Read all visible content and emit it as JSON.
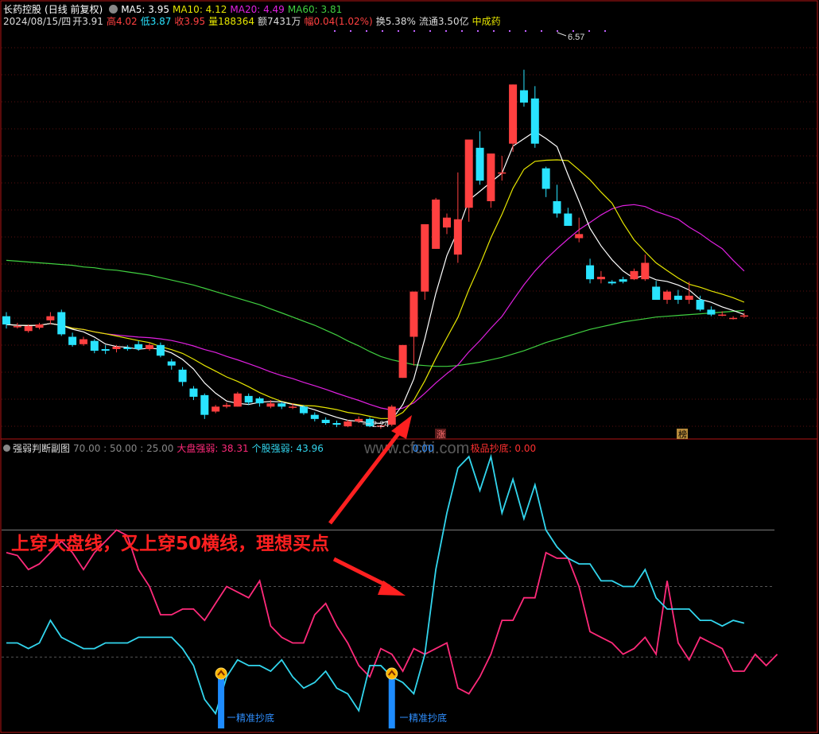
{
  "header": {
    "stock_name": "长药控股",
    "period": "(日线 前复权)",
    "ma5": "MA5: 3.95",
    "ma10": "MA10: 4.12",
    "ma20": "MA20: 4.49",
    "ma60": "MA60: 3.81",
    "date": "2024/08/15/四",
    "open": "开3.91",
    "high": "高4.02",
    "low": "低3.87",
    "close": "收3.95",
    "volume": "量188364",
    "amount": "额7431万",
    "change": "幅0.04(1.02%)",
    "turnover": "换5.38%",
    "float_cap": "流通3.50亿",
    "sector": "中成药"
  },
  "colors": {
    "up": "#ff4040",
    "down": "#29e3ff",
    "ma5": "#ffffff",
    "ma10": "#e6e600",
    "ma20": "#e020e0",
    "ma60": "#40d040",
    "frame": "#b41414",
    "market_line": "#ff2a7a",
    "stock_line": "#32d6ee",
    "signal": "#1e8cff"
  },
  "labels": {
    "max_price": "6.57",
    "min_price": "2.24",
    "zhang_badge": "涨",
    "bang_badge": "榜",
    "sub_title": "强弱判断副图",
    "sub_levels": "70.00 : 50.00 : 25.00",
    "market_strength": "大盘强弱: 38.31",
    "stock_strength": "个股强弱: 43.96",
    "hidden_value": "0.00",
    "extreme_bottom": "极品抄底: 0.00",
    "watermark": "www.cfchi.com",
    "signal_label": "精准抄底",
    "annotation": "上穿大盘线，又上穿50横线，理想买点"
  },
  "chart_data": [
    {
      "type": "candlestick",
      "title": "长药控股 (日线 前复权)",
      "ylim": [
        2.0,
        6.8
      ],
      "candles": [
        [
          3.3,
          3.2,
          3.35,
          3.15
        ],
        [
          3.18,
          3.18,
          3.22,
          3.15
        ],
        [
          3.12,
          3.18,
          3.2,
          3.1
        ],
        [
          3.16,
          3.2,
          3.22,
          3.14
        ],
        [
          3.25,
          3.3,
          3.35,
          3.2
        ],
        [
          3.35,
          3.08,
          3.38,
          3.06
        ],
        [
          3.05,
          2.95,
          3.1,
          2.93
        ],
        [
          2.96,
          3.02,
          3.05,
          2.94
        ],
        [
          3.0,
          2.88,
          3.02,
          2.85
        ],
        [
          2.9,
          2.88,
          2.95,
          2.84
        ],
        [
          2.9,
          2.93,
          2.95,
          2.86
        ],
        [
          2.92,
          2.9,
          2.95,
          2.88
        ],
        [
          2.96,
          2.9,
          3.0,
          2.88
        ],
        [
          2.9,
          2.95,
          2.98,
          2.88
        ],
        [
          2.95,
          2.82,
          2.98,
          2.8
        ],
        [
          2.75,
          2.7,
          2.78,
          2.65
        ],
        [
          2.65,
          2.5,
          2.68,
          2.45
        ],
        [
          2.42,
          2.32,
          2.45,
          2.28
        ],
        [
          2.34,
          2.1,
          2.36,
          2.05
        ],
        [
          2.14,
          2.2,
          2.22,
          2.12
        ],
        [
          2.2,
          2.22,
          2.25,
          2.18
        ],
        [
          2.2,
          2.36,
          2.38,
          2.2
        ],
        [
          2.33,
          2.25,
          2.36,
          2.22
        ],
        [
          2.3,
          2.24,
          2.32,
          2.2
        ],
        [
          2.2,
          2.24,
          2.28,
          2.18
        ],
        [
          2.24,
          2.2,
          2.26,
          2.17
        ],
        [
          2.2,
          2.2,
          2.24,
          2.17
        ],
        [
          2.2,
          2.12,
          2.22,
          2.1
        ],
        [
          2.1,
          2.05,
          2.13,
          2.02
        ],
        [
          2.04,
          2.0,
          2.07,
          1.98
        ],
        [
          2.0,
          1.98,
          2.03,
          1.95
        ],
        [
          1.96,
          2.02,
          2.04,
          1.95
        ],
        [
          2.02,
          2.05,
          2.08,
          2.0
        ],
        [
          2.05,
          1.96,
          2.07,
          1.95
        ],
        [
          1.96,
          1.97,
          1.98,
          1.93
        ],
        [
          1.98,
          2.2,
          2.22,
          1.96
        ],
        [
          2.55,
          2.95,
          2.95,
          2.55
        ],
        [
          3.05,
          3.6,
          3.6,
          2.7
        ],
        [
          3.6,
          4.42,
          4.42,
          3.5
        ],
        [
          4.12,
          4.72,
          4.74,
          4.12
        ],
        [
          4.38,
          4.5,
          4.55,
          4.3
        ],
        [
          4.05,
          4.48,
          5.05,
          3.95
        ],
        [
          4.62,
          5.45,
          5.45,
          4.45
        ],
        [
          5.35,
          4.95,
          5.55,
          4.9
        ],
        [
          4.7,
          5.28,
          5.28,
          4.62
        ],
        [
          5.05,
          5.05,
          5.25,
          4.95
        ],
        [
          5.4,
          6.12,
          6.12,
          5.3
        ],
        [
          6.05,
          5.9,
          6.3,
          5.85
        ],
        [
          5.95,
          5.4,
          6.1,
          5.35
        ],
        [
          5.1,
          4.85,
          5.12,
          4.75
        ],
        [
          4.7,
          4.55,
          4.9,
          4.5
        ],
        [
          4.55,
          4.4,
          4.62,
          4.4
        ],
        [
          4.25,
          4.3,
          4.5,
          4.2
        ],
        [
          3.92,
          3.75,
          4.0,
          3.7
        ],
        [
          3.75,
          3.78,
          3.85,
          3.7
        ],
        [
          3.72,
          3.7,
          3.74,
          3.68
        ],
        [
          3.75,
          3.72,
          3.78,
          3.7
        ],
        [
          3.75,
          3.85,
          3.88,
          3.74
        ],
        [
          3.75,
          3.95,
          4.05,
          3.73
        ],
        [
          3.66,
          3.5,
          3.73,
          3.5
        ],
        [
          3.5,
          3.6,
          3.62,
          3.45
        ],
        [
          3.55,
          3.5,
          3.62,
          3.45
        ],
        [
          3.5,
          3.55,
          3.72,
          3.45
        ],
        [
          3.5,
          3.38,
          3.55,
          3.36
        ],
        [
          3.38,
          3.32,
          3.42,
          3.3
        ],
        [
          3.32,
          3.32,
          3.36,
          3.3
        ],
        [
          3.28,
          3.28,
          3.3,
          3.26
        ],
        [
          3.3,
          3.31,
          3.34,
          3.28
        ]
      ],
      "ma60": [
        3.98,
        3.97,
        3.96,
        3.95,
        3.94,
        3.93,
        3.92,
        3.9,
        3.89,
        3.87,
        3.86,
        3.84,
        3.82,
        3.8,
        3.77,
        3.74,
        3.71,
        3.68,
        3.64,
        3.6,
        3.56,
        3.52,
        3.48,
        3.44,
        3.39,
        3.34,
        3.29,
        3.24,
        3.19,
        3.13,
        3.07,
        3.0,
        2.94,
        2.87,
        2.81,
        2.77,
        2.74,
        2.71,
        2.7,
        2.69,
        2.69,
        2.7,
        2.72,
        2.74,
        2.77,
        2.8,
        2.84,
        2.88,
        2.93,
        2.98,
        3.02,
        3.06,
        3.1,
        3.14,
        3.17,
        3.2,
        3.23,
        3.25,
        3.27,
        3.29,
        3.3,
        3.31,
        3.32,
        3.33,
        3.34,
        3.35,
        3.36,
        3.37
      ]
    },
    {
      "type": "line",
      "title": "强弱判断副图",
      "ylim": [
        0,
        100
      ],
      "hlines": [
        70,
        50,
        25
      ],
      "series": [
        {
          "name": "大盘强弱",
          "values": [
            62,
            61,
            56,
            58,
            62,
            66,
            62,
            56,
            62,
            66,
            70,
            68,
            56,
            50,
            40,
            40,
            42,
            42,
            38,
            44,
            50,
            48,
            46,
            52,
            36,
            32,
            30,
            30,
            40,
            44,
            36,
            30,
            22,
            18,
            28,
            26,
            20,
            28,
            26,
            28,
            30,
            14,
            12,
            18,
            26,
            38,
            38,
            46,
            46,
            62,
            60,
            60,
            50,
            34,
            32,
            30,
            26,
            28,
            32,
            26,
            52,
            30,
            24,
            32,
            30,
            28,
            20,
            20,
            26,
            22,
            26
          ]
        },
        {
          "name": "个股强弱",
          "values": [
            30,
            30,
            28,
            30,
            38,
            32,
            30,
            28,
            28,
            30,
            30,
            30,
            32,
            32,
            32,
            32,
            28,
            22,
            10,
            5,
            18,
            24,
            22,
            22,
            20,
            24,
            18,
            14,
            16,
            20,
            14,
            12,
            6,
            22,
            22,
            18,
            16,
            12,
            26,
            56,
            76,
            92,
            96,
            84,
            96,
            76,
            88,
            74,
            86,
            70,
            64,
            60,
            58,
            58,
            52,
            52,
            50,
            50,
            56,
            46,
            42,
            42,
            42,
            38,
            38,
            36,
            38,
            37
          ]
        },
        {
          "name": "精准抄底",
          "values": [
            24,
            24
          ]
        }
      ]
    }
  ]
}
